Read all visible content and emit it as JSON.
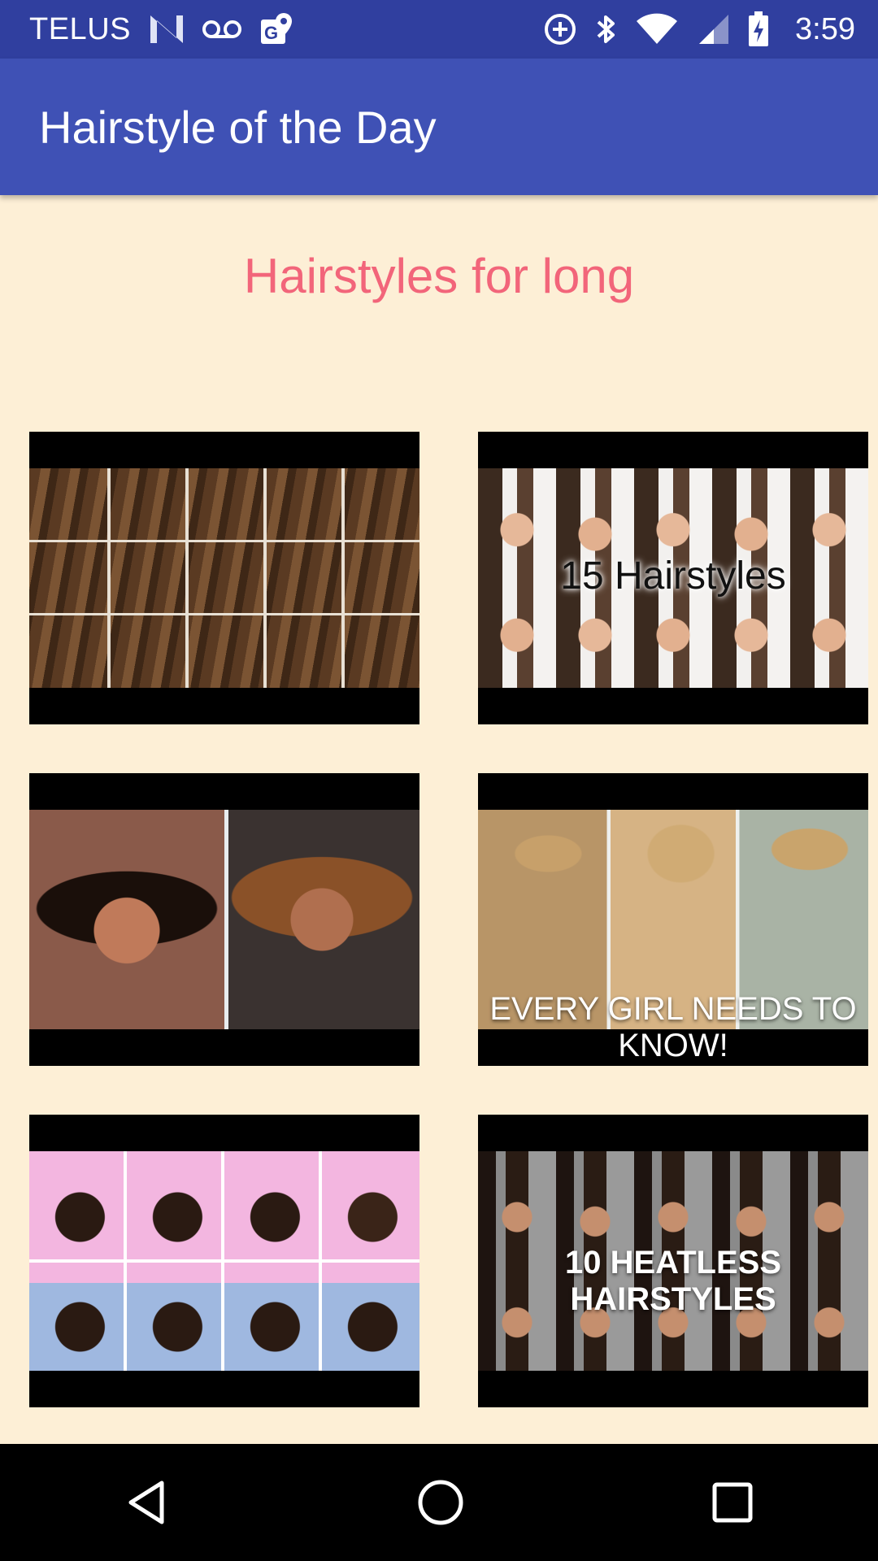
{
  "status_bar": {
    "carrier": "TELUS",
    "time": "3:59",
    "icons": [
      "nfc-n-icon",
      "voicemail-icon",
      "maps-icon",
      "data-saver-icon",
      "bluetooth-icon",
      "wifi-icon",
      "signal-icon",
      "battery-charging-icon"
    ]
  },
  "app_bar": {
    "title": "Hairstyle of the Day"
  },
  "section": {
    "title": "Hairstyles for long"
  },
  "thumbnails": [
    {
      "caption": ""
    },
    {
      "caption": "15 Hairstyles"
    },
    {
      "caption": ""
    },
    {
      "caption": "EVERY GIRL NEEDS TO KNOW!"
    },
    {
      "caption": ""
    },
    {
      "caption": "10 HEATLESS HAIRSTYLES"
    }
  ],
  "nav_bar": {
    "buttons": [
      "back-icon",
      "home-icon",
      "recents-icon"
    ]
  },
  "colors": {
    "status_bar": "#303f9f",
    "app_bar": "#3f51b5",
    "background": "#fdefd6",
    "section_title": "#f2657a"
  }
}
